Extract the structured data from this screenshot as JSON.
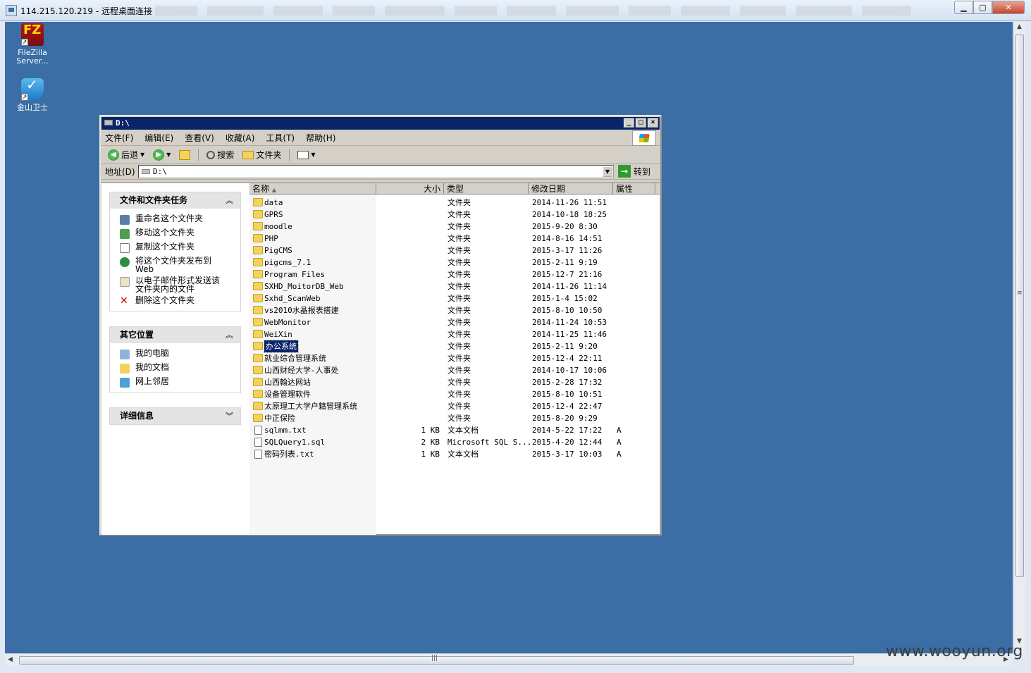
{
  "rdp": {
    "title": "114.215.120.219 - 远程桌面连接"
  },
  "desktop": {
    "icons": [
      {
        "label1": "FileZilla",
        "label2": "Server..."
      },
      {
        "label1": "金山卫士",
        "label2": ""
      }
    ]
  },
  "explorer": {
    "title": "D:\\",
    "menu": [
      "文件(F)",
      "编辑(E)",
      "查看(V)",
      "收藏(A)",
      "工具(T)",
      "帮助(H)"
    ],
    "toolbar": {
      "back": "后退",
      "search": "搜索",
      "folders": "文件夹"
    },
    "address": {
      "label": "地址(D)",
      "value": "D:\\",
      "go": "转到"
    },
    "tasks": {
      "title": "文件和文件夹任务",
      "items": [
        "重命名这个文件夹",
        "移动这个文件夹",
        "复制这个文件夹",
        "将这个文件夹发布到\nWeb",
        "以电子邮件形式发送该\n文件夹内的文件",
        "删除这个文件夹"
      ]
    },
    "places": {
      "title": "其它位置",
      "items": [
        "我的电脑",
        "我的文档",
        "网上邻居"
      ]
    },
    "details": {
      "title": "详细信息"
    },
    "columns": {
      "name": "名称",
      "size": "大小",
      "type": "类型",
      "date": "修改日期",
      "attr": "属性"
    },
    "files": [
      {
        "name": "data",
        "size": "",
        "type": "文件夹",
        "date": "2014-11-26 11:51",
        "attr": "",
        "folder": true
      },
      {
        "name": "GPRS",
        "size": "",
        "type": "文件夹",
        "date": "2014-10-18 18:25",
        "attr": "",
        "folder": true
      },
      {
        "name": "moodle",
        "size": "",
        "type": "文件夹",
        "date": "2015-9-20 8:30",
        "attr": "",
        "folder": true
      },
      {
        "name": "PHP",
        "size": "",
        "type": "文件夹",
        "date": "2014-8-16 14:51",
        "attr": "",
        "folder": true
      },
      {
        "name": "PigCMS",
        "size": "",
        "type": "文件夹",
        "date": "2015-3-17 11:26",
        "attr": "",
        "folder": true
      },
      {
        "name": "pigcms_7.1",
        "size": "",
        "type": "文件夹",
        "date": "2015-2-11 9:19",
        "attr": "",
        "folder": true
      },
      {
        "name": "Program Files",
        "size": "",
        "type": "文件夹",
        "date": "2015-12-7 21:16",
        "attr": "",
        "folder": true
      },
      {
        "name": "SXHD_MoitorDB_Web",
        "size": "",
        "type": "文件夹",
        "date": "2014-11-26 11:14",
        "attr": "",
        "folder": true
      },
      {
        "name": "Sxhd_ScanWeb",
        "size": "",
        "type": "文件夹",
        "date": "2015-1-4 15:02",
        "attr": "",
        "folder": true
      },
      {
        "name": "vs2010水晶报表搭建",
        "size": "",
        "type": "文件夹",
        "date": "2015-8-10 10:50",
        "attr": "",
        "folder": true
      },
      {
        "name": "WebMonitor",
        "size": "",
        "type": "文件夹",
        "date": "2014-11-24 10:53",
        "attr": "",
        "folder": true
      },
      {
        "name": "WeiXin",
        "size": "",
        "type": "文件夹",
        "date": "2014-11-25 11:46",
        "attr": "",
        "folder": true
      },
      {
        "name": "办公系统",
        "size": "",
        "type": "文件夹",
        "date": "2015-2-11 9:20",
        "attr": "",
        "folder": true,
        "selected": true
      },
      {
        "name": "就业综合管理系统",
        "size": "",
        "type": "文件夹",
        "date": "2015-12-4 22:11",
        "attr": "",
        "folder": true
      },
      {
        "name": "山西财经大学-人事处",
        "size": "",
        "type": "文件夹",
        "date": "2014-10-17 10:06",
        "attr": "",
        "folder": true
      },
      {
        "name": "山西翰达网站",
        "size": "",
        "type": "文件夹",
        "date": "2015-2-28 17:32",
        "attr": "",
        "folder": true
      },
      {
        "name": "设备管理软件",
        "size": "",
        "type": "文件夹",
        "date": "2015-8-10 10:51",
        "attr": "",
        "folder": true
      },
      {
        "name": "太原理工大学户籍管理系统",
        "size": "",
        "type": "文件夹",
        "date": "2015-12-4 22:47",
        "attr": "",
        "folder": true
      },
      {
        "name": "中正保险",
        "size": "",
        "type": "文件夹",
        "date": "2015-8-20 9:29",
        "attr": "",
        "folder": true
      },
      {
        "name": "sqlmm.txt",
        "size": "1 KB",
        "type": "文本文档",
        "date": "2014-5-22 17:22",
        "attr": "A",
        "folder": false
      },
      {
        "name": "SQLQuery1.sql",
        "size": "2 KB",
        "type": "Microsoft SQL S...",
        "date": "2015-4-20 12:44",
        "attr": "A",
        "folder": false
      },
      {
        "name": "密码列表.txt",
        "size": "1 KB",
        "type": "文本文档",
        "date": "2015-3-17 10:03",
        "attr": "A",
        "folder": false
      }
    ]
  },
  "watermark": "www.wooyun.org"
}
